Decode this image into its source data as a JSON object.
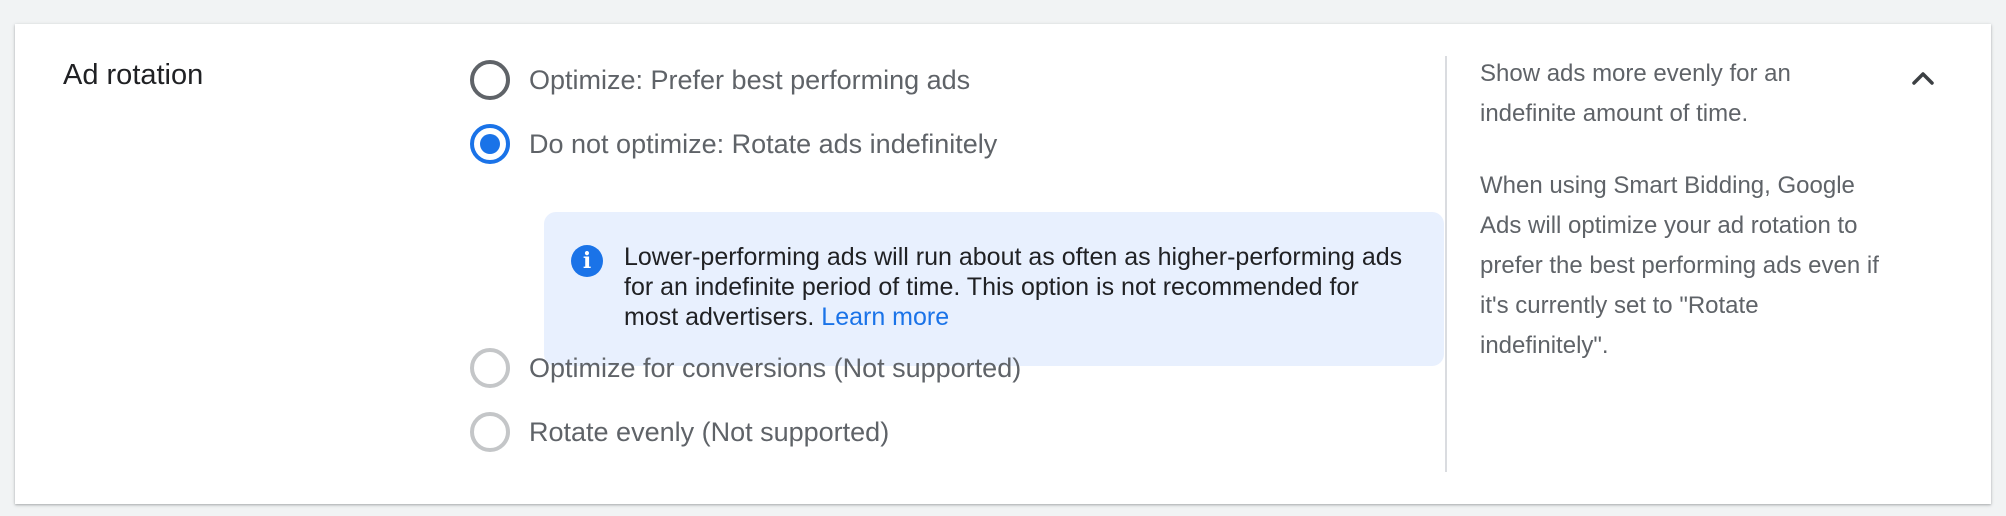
{
  "section": {
    "title": "Ad rotation"
  },
  "options": [
    {
      "label": "Optimize: Prefer best performing ads",
      "selected": false,
      "disabled": false
    },
    {
      "label": "Do not optimize: Rotate ads indefinitely",
      "selected": true,
      "disabled": false
    },
    {
      "label": "Optimize for conversions (Not supported)",
      "selected": false,
      "disabled": true
    },
    {
      "label": "Rotate evenly (Not supported)",
      "selected": false,
      "disabled": true
    }
  ],
  "info": {
    "icon": "info-icon",
    "icon_glyph": "i",
    "text": "Lower-performing ads will run about as often as higher-performing ads for an indefinite period of time. This option is not recommended for most advertisers.",
    "link_label": "Learn more"
  },
  "help": {
    "paragraph1": "Show ads more evenly for an indefinite amount of time.",
    "paragraph2": "When using Smart Bidding, Google Ads will optimize your ad rotation to prefer the best performing ads even if it's currently set to \"Rotate indefinitely\"."
  },
  "controls": {
    "collapse_icon": "chevron-up-icon"
  },
  "colors": {
    "accent": "#1a73e8",
    "info_background": "#e8f0fe",
    "text_primary": "#202124",
    "text_secondary": "#5f6368"
  }
}
